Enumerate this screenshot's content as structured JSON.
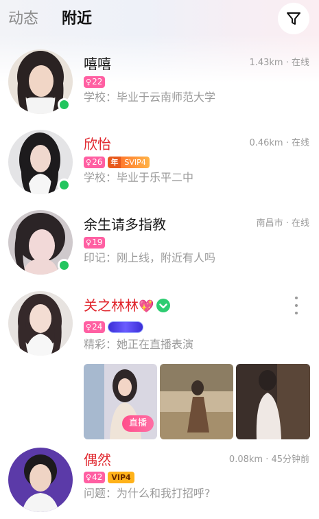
{
  "header": {
    "tabs": [
      {
        "label": "动态",
        "active": false
      },
      {
        "label": "附近",
        "active": true
      }
    ],
    "filter_icon": "filter-funnel-icon"
  },
  "colors": {
    "online": "#22c55e",
    "age_badge": "#ff5fa2",
    "highlight_name": "#e0262d",
    "meta_text": "#9a9a9a"
  },
  "users": [
    {
      "name": "嘻嘻",
      "age": "22",
      "distance": "1.43km",
      "status": "在线",
      "meta": "1.43km · 在线",
      "desc": "学校：毕业于云南师范大学",
      "online": true
    },
    {
      "name": "欣怡",
      "age": "26",
      "badges": [
        "年",
        "SVIP4"
      ],
      "meta": "0.46km · 在线",
      "desc": "学校：毕业于乐平二中",
      "online": true
    },
    {
      "name": "余生请多指教",
      "age": "19",
      "meta": "南昌市 · 在线",
      "desc": "印记：刚上线，附近有人吗",
      "online": true
    },
    {
      "name": "关之林林",
      "age": "24",
      "desc": "精彩：她正在直播表演",
      "verified": true,
      "live_label": "直播"
    },
    {
      "name": "偶然",
      "age": "42",
      "vip": "VIP4",
      "meta": "0.08km · 45分钟前",
      "desc": "问题：为什么和我打招呼?"
    }
  ]
}
